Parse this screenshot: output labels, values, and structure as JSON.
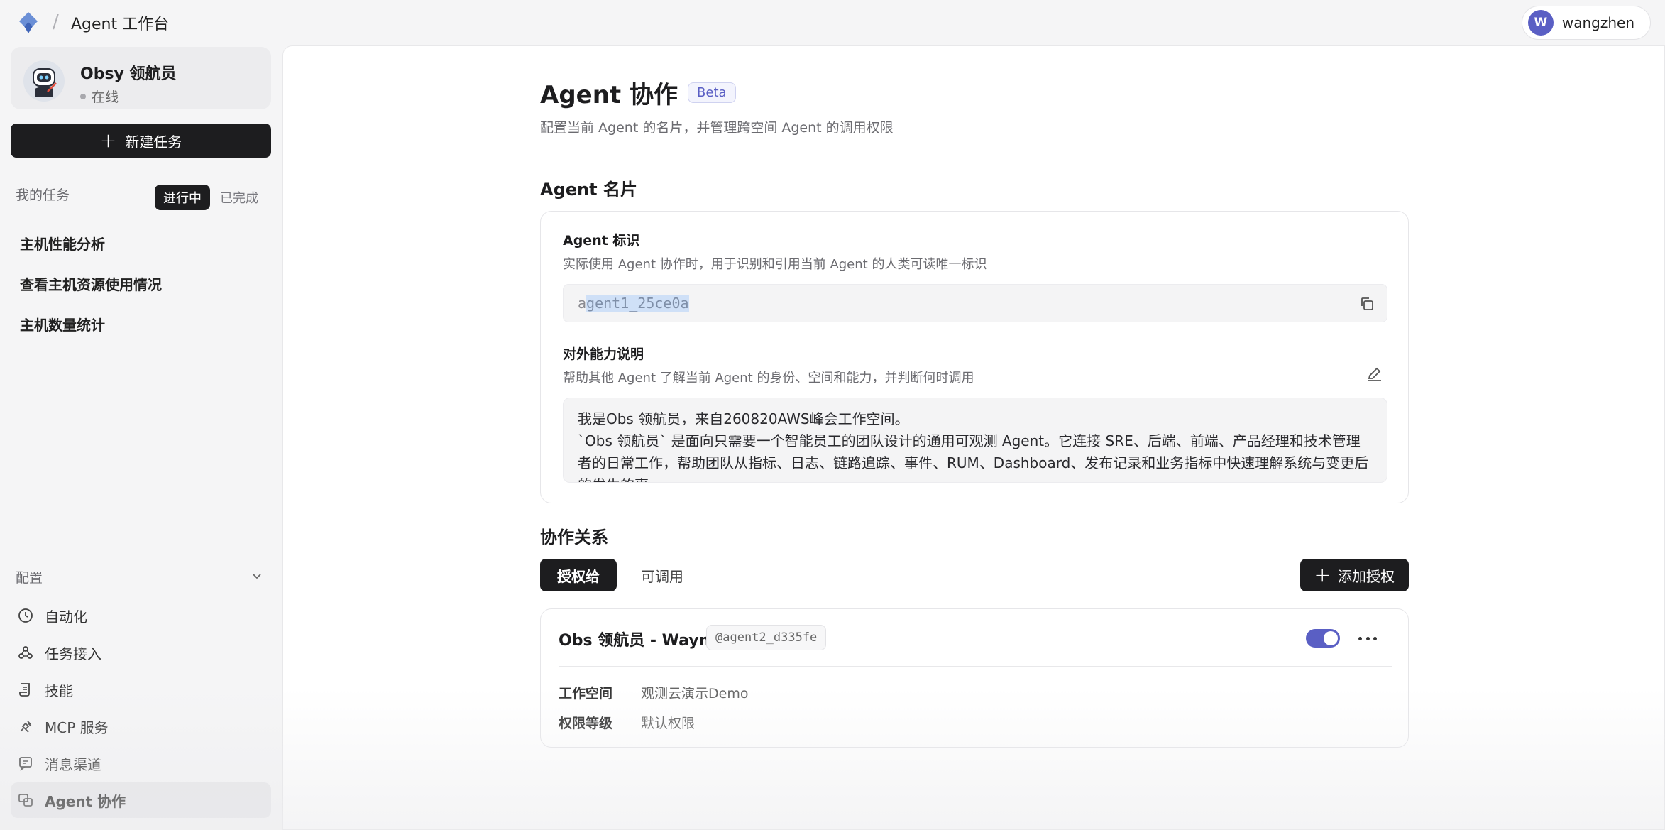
{
  "topbar": {
    "breadcrumb_sep": "/",
    "app_title": "Agent 工作台",
    "user": {
      "initial": "W",
      "name": "wangzhen"
    },
    "icons": {
      "logo": "app-logo-icon"
    }
  },
  "sidebar": {
    "agent": {
      "name": "Obsy 领航员",
      "status": "在线"
    },
    "new_task_label": "新建任务",
    "tasks_header": "我的任务",
    "filters": [
      "进行中",
      "已完成"
    ],
    "tasks": [
      "主机性能分析",
      "查看主机资源使用情况",
      "主机数量统计"
    ],
    "config_header": "配置",
    "nav": [
      {
        "label": "自动化",
        "icon": "clock-icon"
      },
      {
        "label": "任务接入",
        "icon": "webhook-icon"
      },
      {
        "label": "技能",
        "icon": "scroll-icon"
      },
      {
        "label": "MCP 服务",
        "icon": "plug-icon"
      },
      {
        "label": "消息渠道",
        "icon": "message-icon"
      },
      {
        "label": "Agent 协作",
        "icon": "collab-icon"
      }
    ]
  },
  "main": {
    "title": "Agent 协作",
    "badge": "Beta",
    "subtitle": "配置当前 Agent 的名片，并管理跨空间 Agent 的调用权限",
    "card_section": "Agent 名片",
    "id_field": {
      "title": "Agent 标识",
      "desc": "实际使用 Agent 协作时，用于识别和引用当前 Agent 的人类可读唯一标识",
      "value_prefix": "a",
      "value_selected": "gent1_25ce0a"
    },
    "capability_field": {
      "title": "对外能力说明",
      "desc": "帮助其他 Agent 了解当前 Agent 的身份、空间和能力，并判断何时调用",
      "text_line1": "我是Obs 领航员，来自260820AWS峰会工作空间。",
      "text_line2": "`Obs 领航员` 是面向只需要一个智能员工的团队设计的通用可观测 Agent。它连接 SRE、后端、前端、产品经理和技术管理者的日常工作，帮助团队从指标、日志、链路追踪、事件、RUM、Dashboard、发布记录和业务指标中快速理解系统与变更后的发生的事"
    },
    "collab_section": "协作关系",
    "tabs": [
      "授权给",
      "可调用"
    ],
    "add_label": "添加授权",
    "relation": {
      "name": "Obs 领航员 - Wayne",
      "handle": "@agent2_d335fe",
      "enabled": true,
      "workspace_label": "工作空间",
      "workspace_value": "观测云演示Demo",
      "permission_label": "权限等级",
      "permission_value": "默认权限"
    }
  }
}
